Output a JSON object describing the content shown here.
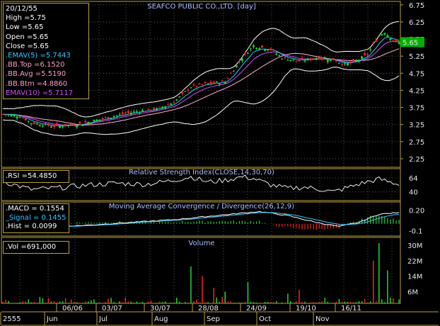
{
  "title": "SEAFCO PUBLIC CO.,LTD. [day]",
  "colors": {
    "up": "#1fd63a",
    "down": "#ff2020",
    "bb": "#ffffff",
    "ema5": "#2ec9ff",
    "ema10": "#d050ff",
    "bbavg": "#ffb0d0",
    "grid": "#585858",
    "frame": "#b8a040",
    "price_marker_bg": "#00b000"
  },
  "info": {
    "date": "20/12/55",
    "high": "High  =5.75",
    "low": "Low   =5.65",
    "open": "Open  =5.65",
    "close": "Close  =5.65",
    "emav5": ".EMAV(5)    =5.7443",
    "bbtop": ".BB.Top    =6.1520",
    "bbavg": ".BB.Avg    =5.5190",
    "bbbtm": ".BB.Btm    =4.8860",
    "emav10": "EMAV(10)  =5.7117"
  },
  "rsi_box": ".RSI   =54.4850",
  "macd_box": {
    "macd": ".MACD  = 0.1554",
    "signal": "_Signal  = 0.1455",
    "hist": ".Hist   = 0.0099"
  },
  "vol_box": ".Vol   =691,000",
  "rsi_title": "Relative Strength Index(CLOSE,14,30,70)",
  "macd_title": "Moving Average Convergence / Divergence(26,12,9)",
  "vol_title": "Volume",
  "price_marker": "5.65",
  "chart_data": {
    "type": "candlestick",
    "price_axis": {
      "ticks": [
        "6.75",
        "6.25",
        "5.75",
        "5.25",
        "4.75",
        "4.25",
        "3.75",
        "3.25",
        "2.75",
        "2.25"
      ],
      "ylim": [
        2.0,
        6.85
      ]
    },
    "rsi_axis": {
      "ticks": [
        "64",
        "40"
      ]
    },
    "macd_axis": {
      "ticks": [
        "0.20",
        "-0.1"
      ]
    },
    "vol_axis": {
      "ticks": [
        "30M",
        "22M",
        "14M",
        "6M"
      ],
      "ylim": [
        0,
        34
      ]
    },
    "x_date_labels": [
      "06/06",
      "03/07",
      "30/07",
      "28/08",
      "24/09",
      "19/10",
      "16/11"
    ],
    "x_month_labels": [
      "2555",
      "Jun",
      "Jul",
      "Aug",
      "Sep",
      "Oct",
      "Nov"
    ],
    "close_anchors": [
      [
        0,
        3.55
      ],
      [
        6,
        3.5
      ],
      [
        10,
        3.3
      ],
      [
        18,
        3.2
      ],
      [
        26,
        3.25
      ],
      [
        34,
        3.4
      ],
      [
        42,
        3.55
      ],
      [
        48,
        3.65
      ],
      [
        54,
        3.7
      ],
      [
        60,
        3.9
      ],
      [
        66,
        4.35
      ],
      [
        72,
        4.45
      ],
      [
        78,
        4.5
      ],
      [
        84,
        5.2
      ],
      [
        88,
        5.55
      ],
      [
        94,
        5.45
      ],
      [
        98,
        5.2
      ],
      [
        104,
        5.1
      ],
      [
        110,
        5.2
      ],
      [
        116,
        5.15
      ],
      [
        120,
        5.0
      ],
      [
        124,
        5.1
      ],
      [
        128,
        5.3
      ],
      [
        132,
        5.85
      ],
      [
        134,
        5.95
      ],
      [
        138,
        5.65
      ]
    ],
    "rsi_anchors": [
      [
        0,
        58
      ],
      [
        10,
        44
      ],
      [
        20,
        47
      ],
      [
        30,
        52
      ],
      [
        40,
        55
      ],
      [
        50,
        53
      ],
      [
        60,
        60
      ],
      [
        66,
        66
      ],
      [
        72,
        57
      ],
      [
        78,
        60
      ],
      [
        84,
        66
      ],
      [
        88,
        63
      ],
      [
        94,
        52
      ],
      [
        100,
        46
      ],
      [
        106,
        48
      ],
      [
        112,
        44
      ],
      [
        116,
        40
      ],
      [
        120,
        46
      ],
      [
        126,
        55
      ],
      [
        132,
        62
      ],
      [
        138,
        54
      ]
    ],
    "macd_anchors": [
      [
        0,
        -0.02
      ],
      [
        15,
        -0.05
      ],
      [
        30,
        -0.02
      ],
      [
        45,
        0.02
      ],
      [
        60,
        0.06
      ],
      [
        75,
        0.12
      ],
      [
        90,
        0.18
      ],
      [
        100,
        0.12
      ],
      [
        110,
        0.02
      ],
      [
        118,
        -0.04
      ],
      [
        125,
        0.02
      ],
      [
        132,
        0.14
      ],
      [
        138,
        0.16
      ]
    ],
    "volume_spikes": [
      [
        66,
        19
      ],
      [
        70,
        14
      ],
      [
        74,
        8
      ],
      [
        78,
        6
      ],
      [
        86,
        11
      ],
      [
        100,
        5
      ],
      [
        104,
        7
      ],
      [
        130,
        22
      ],
      [
        132,
        31
      ],
      [
        135,
        17
      ]
    ]
  }
}
